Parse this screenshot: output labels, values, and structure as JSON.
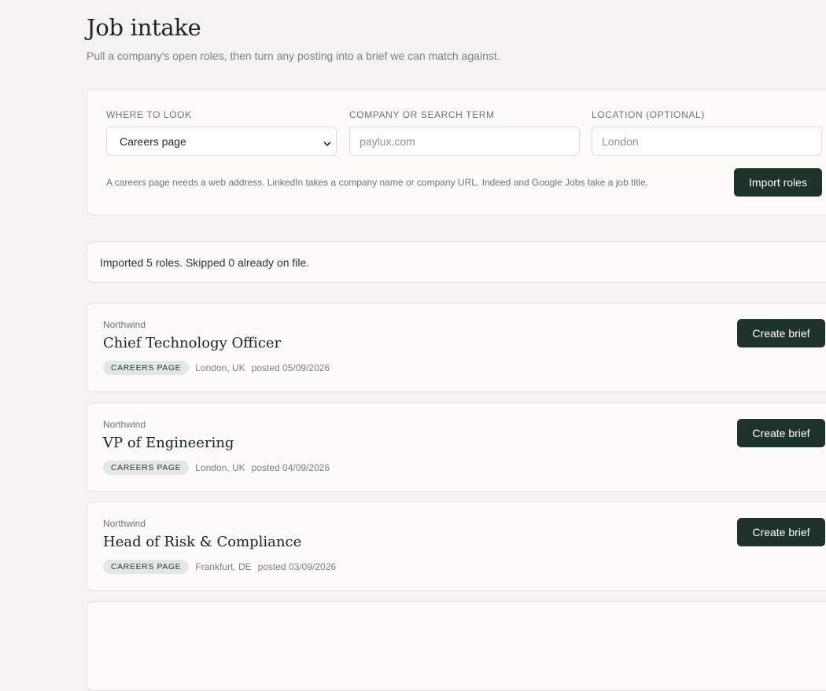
{
  "header": {
    "title": "Job intake",
    "subtitle": "Pull a company's open roles, then turn any posting into a brief we can match against."
  },
  "import_form": {
    "source": {
      "label": "Where to look",
      "value": "Careers page"
    },
    "query": {
      "label": "Company or search term",
      "placeholder": "paylux.com"
    },
    "location": {
      "label": "Location (optional)",
      "placeholder": "London"
    },
    "hint": "A careers page needs a web address. LinkedIn takes a company name or company URL. Indeed and Google Jobs take a job title.",
    "import_label": "Import roles"
  },
  "status": {
    "message": "Imported 5 roles. Skipped 0 already on file."
  },
  "roles": [
    {
      "company": "Northwind",
      "title": "Chief Technology Officer",
      "source": "Careers page",
      "location": "London, UK",
      "posted": "posted 05/09/2026",
      "action": "Create brief"
    },
    {
      "company": "Northwind",
      "title": "VP of Engineering",
      "source": "Careers page",
      "location": "London, UK",
      "posted": "posted 04/09/2026",
      "action": "Create brief"
    },
    {
      "company": "Northwind",
      "title": "Head of Risk & Compliance",
      "source": "Careers page",
      "location": "Frankfurt, DE",
      "posted": "posted 03/09/2026",
      "action": "Create brief"
    }
  ]
}
